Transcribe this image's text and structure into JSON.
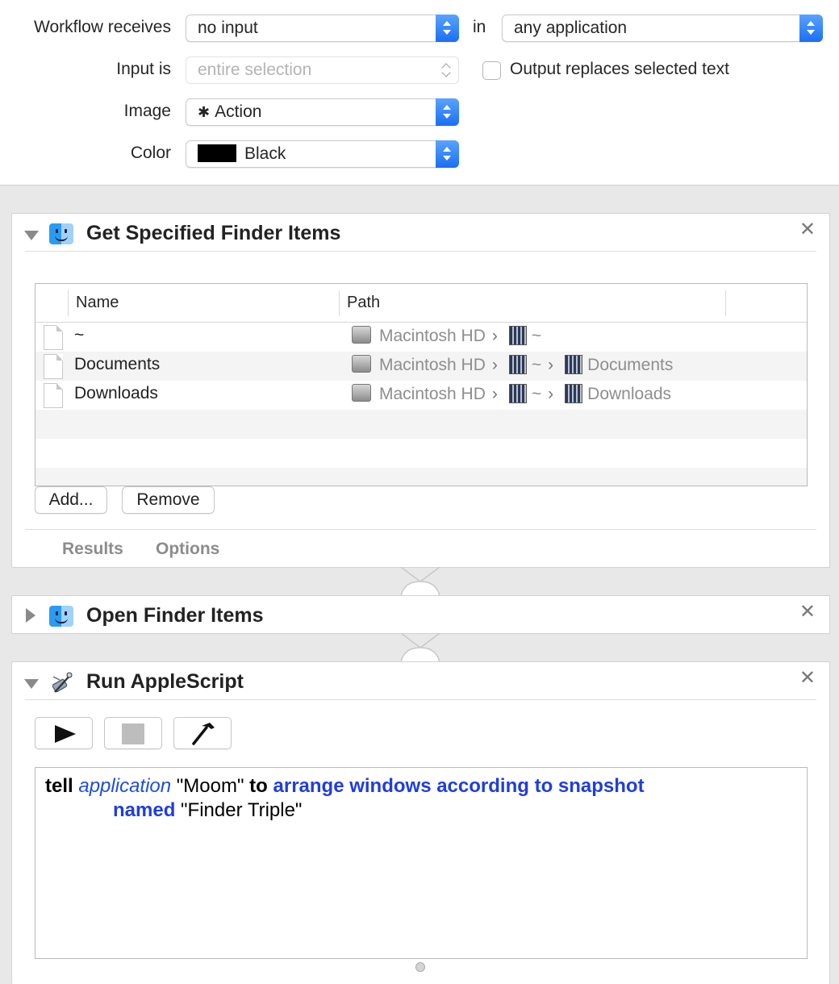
{
  "settings": {
    "workflow_receives_label": "Workflow receives",
    "workflow_receives_value": "no input",
    "in_label": "in",
    "application_value": "any application",
    "input_is_label": "Input is",
    "input_is_value": "entire selection",
    "output_replaces_label": "Output replaces selected text",
    "output_replaces_checked": false,
    "image_label": "Image",
    "image_value": "Action",
    "image_icon": "gear-icon",
    "color_label": "Color",
    "color_value": "Black",
    "color_swatch": "#000000"
  },
  "action1": {
    "title": "Get Specified Finder Items",
    "columns": [
      "Name",
      "Path"
    ],
    "rows": [
      {
        "name": "~",
        "path": [
          "Macintosh HD",
          "~"
        ]
      },
      {
        "name": "Documents",
        "path": [
          "Macintosh HD",
          "~",
          "Documents"
        ]
      },
      {
        "name": "Downloads",
        "path": [
          "Macintosh HD",
          "~",
          "Downloads"
        ]
      }
    ],
    "add_label": "Add...",
    "remove_label": "Remove",
    "tabs": [
      "Results",
      "Options"
    ]
  },
  "action2": {
    "title": "Open Finder Items"
  },
  "action3": {
    "title": "Run AppleScript",
    "code": {
      "tell": "tell",
      "application": "application",
      "app_name": "\"Moom\"",
      "to": "to",
      "command": "arrange windows according to snapshot",
      "named": "named",
      "snapshot_name": "\"Finder Triple\""
    }
  },
  "colors": {
    "accent": "#1a6ff2",
    "command_blue": "#1f3de0"
  }
}
